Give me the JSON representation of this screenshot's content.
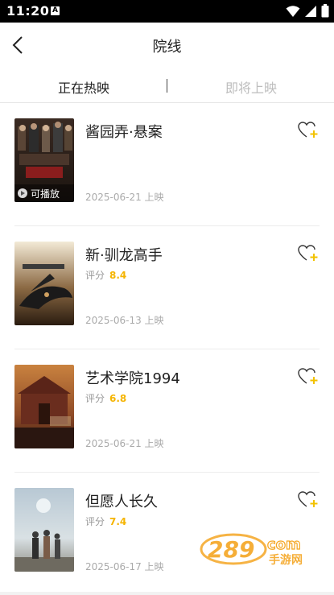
{
  "status": {
    "time": "11:20",
    "badge": "A"
  },
  "header": {
    "title": "院线"
  },
  "tabs": [
    {
      "label": "正在热映",
      "active": true
    },
    {
      "label": "即将上映",
      "active": false
    }
  ],
  "movies": [
    {
      "title": "酱园弄·悬案",
      "score_label": "",
      "score": "",
      "date": "2025-06-21 上映",
      "playable": "可播放"
    },
    {
      "title": "新·驯龙高手",
      "score_label": "评分",
      "score": "8.4",
      "date": "2025-06-13 上映",
      "playable": ""
    },
    {
      "title": "艺术学院1994",
      "score_label": "评分",
      "score": "6.8",
      "date": "2025-06-21 上映",
      "playable": ""
    },
    {
      "title": "但愿人长久",
      "score_label": "评分",
      "score": "7.4",
      "date": "2025-06-17 上映",
      "playable": ""
    }
  ],
  "watermark": {
    "brand": "289",
    "suffix": "com",
    "sub": "手游网"
  },
  "colors": {
    "accent": "#f5b400",
    "heart_plus": "#f2c200",
    "watermark": "#f5a623"
  }
}
